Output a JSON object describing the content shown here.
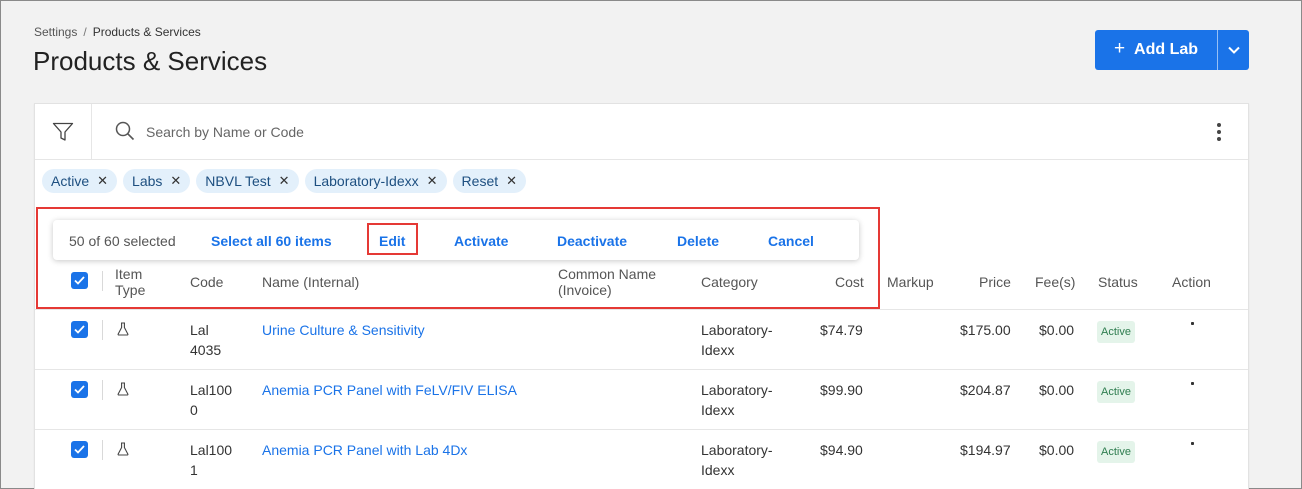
{
  "breadcrumb": {
    "root": "Settings",
    "separator": "/",
    "current": "Products & Services"
  },
  "page_title": "Products & Services",
  "add_button": {
    "label": "Add Lab",
    "plus": "+"
  },
  "search": {
    "placeholder": "Search by Name or Code"
  },
  "filter_chips": [
    "Active",
    "Labs",
    "NBVL Test",
    "Laboratory-Idexx",
    "Reset"
  ],
  "bulk_bar": {
    "count_text": "50 of 60 selected",
    "select_all": "Select all 60 items",
    "edit": "Edit",
    "activate": "Activate",
    "deactivate": "Deactivate",
    "delete": "Delete",
    "cancel": "Cancel"
  },
  "columns": {
    "item_type": [
      "Item",
      "Type"
    ],
    "code": "Code",
    "name": "Name (Internal)",
    "common_name": [
      "Common Name",
      "(Invoice)"
    ],
    "category": "Category",
    "cost": "Cost",
    "markup": "Markup",
    "price": "Price",
    "fees": "Fee(s)",
    "status": "Status",
    "action": "Action"
  },
  "rows": [
    {
      "code": [
        "Lal",
        "4035"
      ],
      "name": "Urine Culture & Sensitivity",
      "category": [
        "Laboratory-",
        "Idexx"
      ],
      "cost": "$74.79",
      "price": "$175.00",
      "fees": "$0.00",
      "status": "Active"
    },
    {
      "code": [
        "Lal100",
        "0"
      ],
      "name": "Anemia PCR Panel with FeLV/FIV ELISA",
      "category": [
        "Laboratory-",
        "Idexx"
      ],
      "cost": "$99.90",
      "price": "$204.87",
      "fees": "$0.00",
      "status": "Active"
    },
    {
      "code": [
        "Lal100",
        "1"
      ],
      "name": "Anemia PCR Panel with Lab 4Dx",
      "category": [
        "Laboratory-",
        "Idexx"
      ],
      "cost": "$94.90",
      "price": "$194.97",
      "fees": "$0.00",
      "status": "Active"
    }
  ],
  "colors": {
    "accent": "#1a73e8",
    "highlight": "#e53935",
    "chip_bg": "#e3f0fb",
    "status_bg": "#e4f4ea",
    "status_text": "#2e7d4f"
  },
  "icons": {
    "filter": "filter-icon",
    "search": "search-icon",
    "more": "more-vertical-icon",
    "item_type": "flask-icon",
    "checkbox": "check-icon",
    "chevron": "chevron-down-icon",
    "chip_remove": "close-icon"
  }
}
